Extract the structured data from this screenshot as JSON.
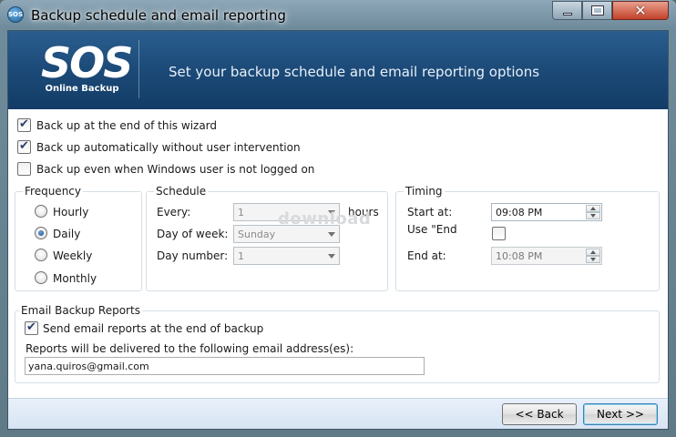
{
  "window": {
    "title": "Backup schedule and email reporting",
    "app_icon_text": "SOS",
    "minimize_icon": "minimize-icon",
    "maximize_icon": "maximize-icon",
    "close_icon": "close-icon"
  },
  "banner": {
    "logo_main": "SOS",
    "logo_sub": "Online Backup",
    "subtitle": "Set your backup schedule and email reporting options",
    "colors": {
      "top": "#2a5e8f",
      "bottom": "#123c66"
    }
  },
  "options": [
    {
      "label": "Back up at the end of this wizard",
      "checked": true
    },
    {
      "label": "Back up automatically without user intervention",
      "checked": true
    },
    {
      "label": "Back up even when Windows user is not logged on",
      "checked": false
    }
  ],
  "frequency": {
    "title": "Frequency",
    "options": [
      {
        "label": "Hourly",
        "selected": false
      },
      {
        "label": "Daily",
        "selected": true
      },
      {
        "label": "Weekly",
        "selected": false
      },
      {
        "label": "Monthly",
        "selected": false
      }
    ]
  },
  "schedule": {
    "title": "Schedule",
    "every_label": "Every:",
    "every_value": "1",
    "every_unit": "hours",
    "day_of_week_label": "Day of week:",
    "day_of_week_value": "Sunday",
    "day_number_label": "Day number:",
    "day_number_value": "1"
  },
  "timing": {
    "title": "Timing",
    "start_label": "Start at:",
    "start_value": "09:08 PM",
    "use_end_label": "Use \"End",
    "use_end_checked": false,
    "end_label": "End at:",
    "end_value": "10:08 PM"
  },
  "email": {
    "title": "Email Backup Reports",
    "send_label": "Send email reports at the end of backup",
    "send_checked": true,
    "address_label": "Reports will be delivered to the following email address(es):",
    "address_value": "yana.quiros@gmail.com"
  },
  "watermark": "download",
  "footer": {
    "back_label": "<< Back",
    "next_label": "Next >>"
  }
}
